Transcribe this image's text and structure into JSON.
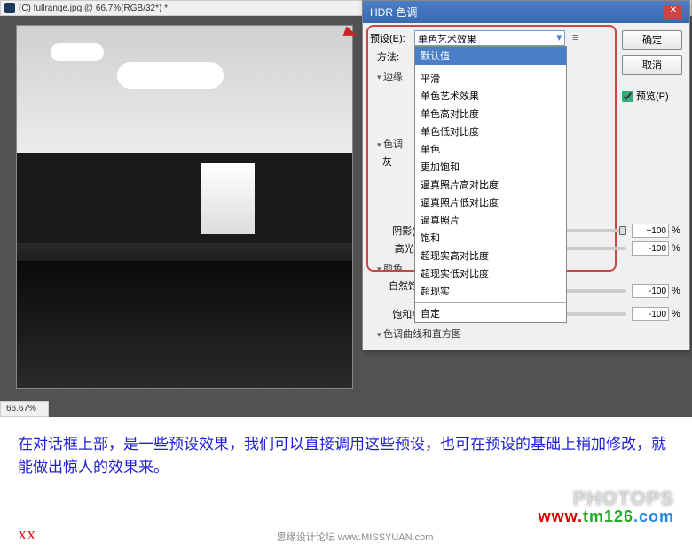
{
  "doc": {
    "title": "(C) fullrange.jpg @ 66.7%(RGB/32*) *",
    "zoom": "66.67%"
  },
  "dialog": {
    "title": "HDR 色调",
    "preset_label": "预设(E):",
    "preset_value": "单色艺术效果",
    "method_label": "方法:",
    "ok": "确定",
    "cancel": "取消",
    "preview": "预览(P)",
    "options": [
      "默认值",
      "平滑",
      "单色艺术效果",
      "单色高对比度",
      "单色低对比度",
      "单色",
      "更加饱和",
      "逼真照片高对比度",
      "逼真照片低对比度",
      "逼真照片",
      "饱和",
      "超现实高对比度",
      "超现实低对比度",
      "超现实",
      "自定"
    ],
    "section_edge": "边缘",
    "section_tone": "色调",
    "section_color": "颜色",
    "section_curve": "色调曲线和直方图",
    "tone_gray": "灰",
    "shadow_label": "阴影(W):",
    "shadow_val": "+100",
    "highlight_label": "高光(H):",
    "highlight_val": "-100",
    "vibrance_label": "自然饱和度(V):",
    "vibrance_val": "-100",
    "saturation_label": "饱和度(A):",
    "saturation_val": "-100",
    "pct": "%"
  },
  "caption": "在对话框上部，是一些预设效果，我们可以直接调用这些预设，也可在预设的基础上稍加修改，就能做出惊人的效果来。",
  "footer": {
    "xx": "XX",
    "forum": "思缘设计论坛 www.MISSYUAN.com",
    "url": "www.tm126.com",
    "wm": "PHOTOPS"
  }
}
